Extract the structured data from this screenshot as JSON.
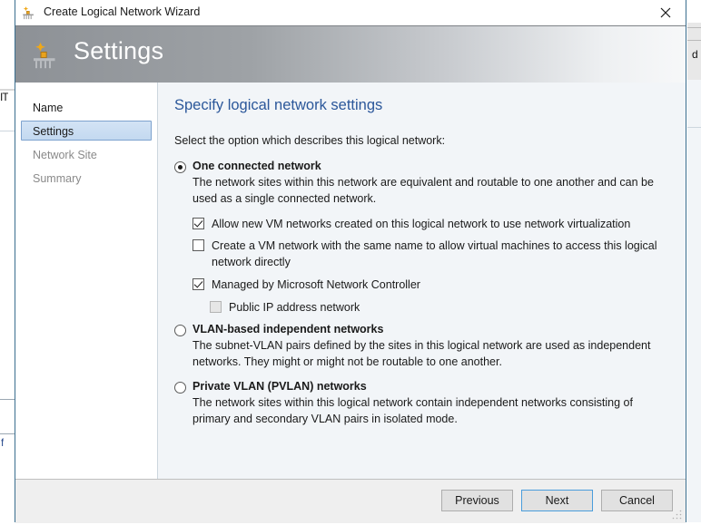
{
  "window": {
    "title": "Create Logical Network Wizard",
    "icon": "logical-network-icon",
    "close_label": "✕"
  },
  "header": {
    "title": "Settings",
    "icon": "logical-network-icon"
  },
  "sidebar": {
    "items": [
      {
        "label": "Name",
        "state": "completed"
      },
      {
        "label": "Settings",
        "state": "selected"
      },
      {
        "label": "Network Site",
        "state": "disabled"
      },
      {
        "label": "Summary",
        "state": "disabled"
      }
    ]
  },
  "content": {
    "title": "Specify logical network settings",
    "instruction": "Select the option which describes this logical network:",
    "options": [
      {
        "label": "One connected network",
        "selected": true,
        "description": "The network sites within this network are equivalent and routable to one another and can be used as a single connected network.",
        "checkboxes": [
          {
            "label": "Allow new VM networks created on this logical network to use network virtualization",
            "checked": true,
            "disabled": false,
            "indent": false
          },
          {
            "label": "Create a VM network with the same name to allow virtual machines to access this logical network directly",
            "checked": false,
            "disabled": false,
            "indent": false
          },
          {
            "label": "Managed by Microsoft Network Controller",
            "checked": true,
            "disabled": false,
            "indent": false
          },
          {
            "label": "Public IP address network",
            "checked": false,
            "disabled": true,
            "indent": true
          }
        ]
      },
      {
        "label": "VLAN-based independent networks",
        "selected": false,
        "description": "The subnet-VLAN pairs defined by the sites in this logical network are used as independent networks. They might or might not be routable to one another.",
        "checkboxes": []
      },
      {
        "label": "Private VLAN (PVLAN) networks",
        "selected": false,
        "description": "The network sites within this logical network contain independent networks consisting of primary and secondary VLAN pairs in isolated mode.",
        "checkboxes": []
      }
    ]
  },
  "footer": {
    "previous_label": "Previous",
    "next_label": "Next",
    "cancel_label": "Cancel"
  },
  "background": {
    "left_fragment_top": "IT",
    "left_fragment_bottom": "f",
    "right_fragment": "d"
  },
  "colors": {
    "accent_blue": "#2b579a",
    "selection_blue": "#c3d9f0",
    "default_button_border": "#4a9ddc",
    "window_border": "#3a6e8f",
    "content_bg": "#f2f5f8",
    "footer_bg": "#efefef"
  }
}
